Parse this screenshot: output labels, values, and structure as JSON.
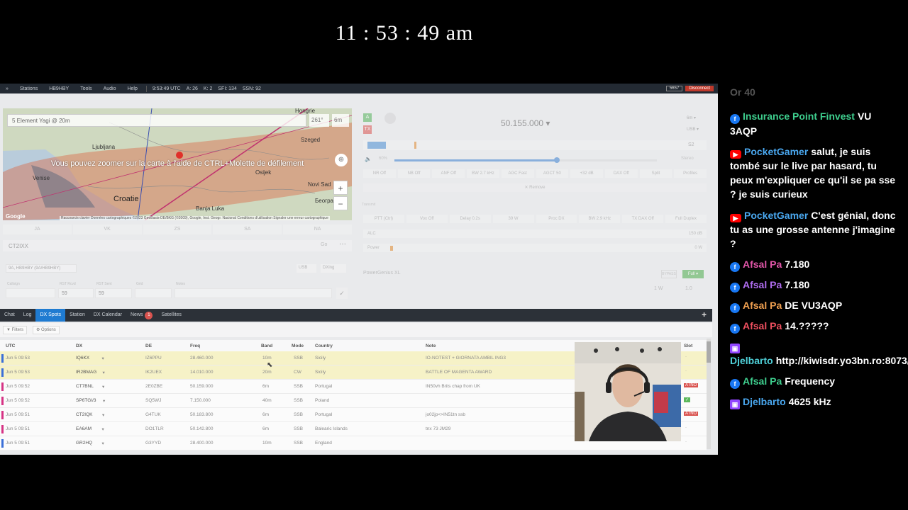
{
  "clock": "11 : 53 : 49 am",
  "topbar": {
    "nav": [
      "Stations",
      "HB9HBY",
      "Tools",
      "Audio",
      "Help"
    ],
    "stats": [
      "9:53:49 UTC",
      "A: 26",
      "K: 2",
      "SFI: 134",
      "SSN: 92"
    ],
    "port": "5657",
    "disconnect": "Disconnect"
  },
  "map": {
    "antenna": "5 Element Yagi @ 20m",
    "bearing": "261°",
    "band": "6m",
    "hint": "Vous pouvez zoomer sur la carte à l'aide de CTRL+Molette de défilement",
    "cities": {
      "hongrie": "Hongrie",
      "ljubljana": "Ljubljana",
      "venise": "Venise",
      "croatie": "Croatie",
      "szeged": "Szeged",
      "novi_sad": "Novi Sad",
      "osijek": "Osijek",
      "banja_luka": "Banja Luka",
      "beograd": "Београд"
    },
    "copyright": "Raccourcis clavier   Données cartographiques ©2023 GeoBasis-DE/BKG (©2009), Google, Inst. Geogr. Nacional   Conditions d'utilisation   Signaler une erreur cartographique",
    "google": "Google"
  },
  "regions": [
    "JA",
    "VK",
    "ZS",
    "SA",
    "NA"
  ],
  "callsign_entry": "CT2IXX",
  "go": "Go",
  "station_select": "9A, HB9HBY (9A/HB9HBY)",
  "mode_select": "USB",
  "dxing_select": "DXing",
  "log_form": {
    "labels": [
      "Callsign",
      "RST Rcvd",
      "RST Sent",
      "Grid",
      "Notes"
    ],
    "rst_rcvd": "59",
    "rst_sent": "59"
  },
  "radio": {
    "slice": "A",
    "tx": "TX",
    "frequency": "50.155.000",
    "band": "6m",
    "mode": "USB",
    "smeter": "S2",
    "volume": "60%",
    "stereo": "Stereo",
    "dsp": [
      "NR Off",
      "NB Off",
      "ANF Off",
      "BW 2.7 kHz",
      "AGC Fast",
      "AGCT 50",
      "+32 dB",
      "DAX Off",
      "Split",
      "Profiles"
    ],
    "remove": "Remove",
    "transmit_label": "Transmit",
    "tx_row": [
      "PTT (Ctrl)",
      "Vox Off",
      "Delay 0.2s",
      "39 W",
      "Proc DX",
      "BW 2.9 kHz",
      "TX DAX Off",
      "Full Duplex"
    ],
    "alc": "ALC",
    "alc_val": "150 dB",
    "power": "Power",
    "power_val": "0 W"
  },
  "amp": {
    "name": "PowerGenius XL",
    "bypass": "BYPASS",
    "full": "Full",
    "watts": "1 W",
    "swr": "1.0"
  },
  "tabs": [
    "Chat",
    "Log",
    "DX Spots",
    "Station",
    "DX Calendar",
    "News",
    "Satellites"
  ],
  "news_count": "1",
  "spot_buttons": {
    "filters": "Filters",
    "options": "Options"
  },
  "spot_headers": [
    "UTC",
    "DX",
    "DE",
    "Freq",
    "Band",
    "Mode",
    "Country",
    "Note",
    "Slot"
  ],
  "spots": [
    {
      "utc": "Jun 5 09:53",
      "dx": "IQ6KX",
      "de": "IZ6PPU",
      "freq": "28.460.000",
      "band": "10m",
      "mode": "SSB",
      "country": "Sicily",
      "note": "IO-NOTEST + GIORNATA AMBIL ING3",
      "slot": "·",
      "hl": true,
      "color": "#3a6fd8"
    },
    {
      "utc": "Jun 5 09:53",
      "dx": "IR2BMAG",
      "de": "IK2UEX",
      "freq": "14.010.000",
      "band": "20m",
      "mode": "CW",
      "country": "Sicily",
      "note": "BATTLE OF MAGENTA AWARD",
      "slot": "·",
      "hl": true,
      "color": "#3a6fd8"
    },
    {
      "utc": "Jun 5 09:52",
      "dx": "CT7BNL",
      "de": "2E0ZBE",
      "freq": "50.159.000",
      "band": "6m",
      "mode": "SSB",
      "country": "Portugal",
      "note": "IN50vh Brits chap from UK",
      "slot": "ATNO",
      "hl": false,
      "color": "#d63384"
    },
    {
      "utc": "Jun 5 09:52",
      "dx": "SP6TGI/3",
      "de": "SQ5WJ",
      "freq": "7.150.000",
      "band": "40m",
      "mode": "SSB",
      "country": "Poland",
      "note": "",
      "slot": "✓",
      "hl": false,
      "color": "#d63384"
    },
    {
      "utc": "Jun 5 09:51",
      "dx": "CT2IQK",
      "de": "G4TUK",
      "freq": "50.183.800",
      "band": "6m",
      "mode": "SSB",
      "country": "Portugal",
      "note": "jo02jp<>IN51tn ssb",
      "slot": "ATNO",
      "hl": false,
      "color": "#d63384"
    },
    {
      "utc": "Jun 5 09:51",
      "dx": "EA6AM",
      "de": "DO1TLR",
      "freq": "50.142.800",
      "band": "6m",
      "mode": "SSB",
      "country": "Balearic Islands",
      "note": "tnx 73 JM29",
      "slot": "·",
      "hl": false,
      "color": "#d63384"
    },
    {
      "utc": "Jun 5 09:51",
      "dx": "GR2HQ",
      "de": "G3YYD",
      "freq": "28.400.000",
      "band": "10m",
      "mode": "SSB",
      "country": "England",
      "note": "",
      "slot": "·",
      "hl": false,
      "color": "#3a6fd8"
    }
  ],
  "chat": {
    "faded": "Or 40",
    "messages": [
      {
        "platform": "facebook",
        "user": "Insurance Point Finvest",
        "text": "VU 3AQP",
        "color": "#3ecf8e"
      },
      {
        "platform": "youtube",
        "user": "PocketGamer",
        "text": "salut, je suis tombé sur le live par hasard, tu peux m'expliquer ce qu'il se pa sse ? je suis curieux",
        "color": "#4aa8f0"
      },
      {
        "platform": "youtube",
        "user": "PocketGamer",
        "text": "C'est génial, donc tu as une grosse antenne j'imagine ?",
        "color": "#4aa8f0"
      },
      {
        "platform": "facebook",
        "user": "Afsal Pa",
        "text": "7.180",
        "color": "#e056a8"
      },
      {
        "platform": "facebook",
        "user": "Afsal Pa",
        "text": "7.180",
        "color": "#b06df0"
      },
      {
        "platform": "facebook",
        "user": "Afsal Pa",
        "text": "DE VU3AQP",
        "color": "#f0a050"
      },
      {
        "platform": "facebook",
        "user": "Afsal Pa",
        "text": "14.?????",
        "color": "#f05060"
      },
      {
        "platform": "twitch",
        "user": "Djelbarto",
        "text": "http://kiwisdr.yo3bn.ro:8073/",
        "color": "#4fd1d9"
      },
      {
        "platform": "facebook",
        "user": "Afsal Pa",
        "text": "Frequency",
        "color": "#3ecf8e"
      },
      {
        "platform": "twitch",
        "user": "Djelbarto",
        "text": "4625 kHz",
        "color": "#4aa8f0"
      }
    ]
  }
}
